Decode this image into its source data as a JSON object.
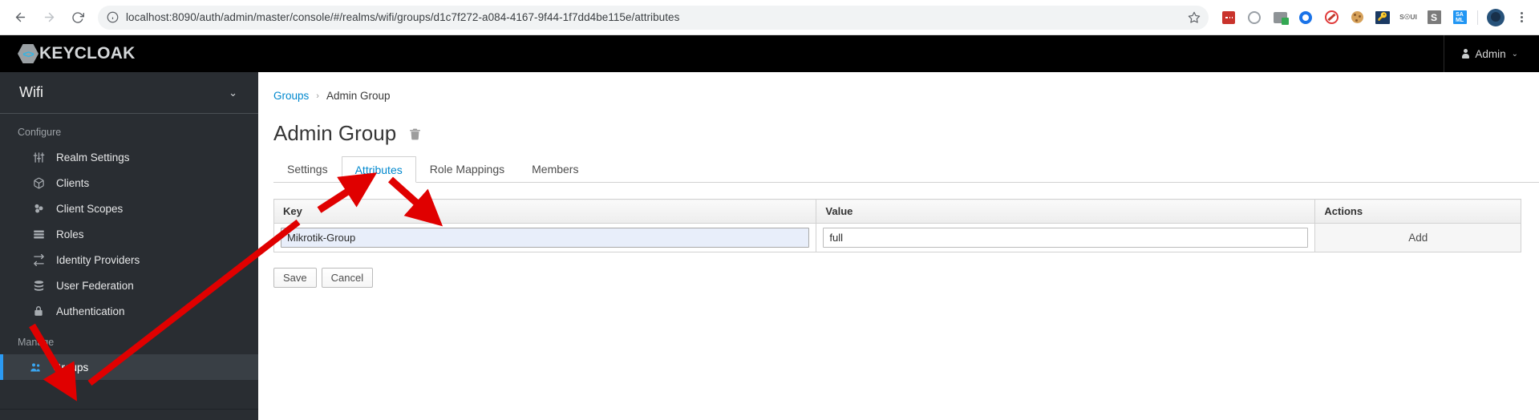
{
  "browser": {
    "back_label": "Back",
    "forward_label": "Forward",
    "reload_label": "Reload",
    "url": "localhost:8090/auth/admin/master/console/#/realms/wifi/groups/d1c7f272-a084-4167-9f44-1f7dd4be115e/attributes",
    "site_info_label": "View site information",
    "bookmark_label": "Bookmark this tab",
    "extensions": [
      {
        "name": "ublock-origin-icon",
        "label": "uBlock Origin"
      },
      {
        "name": "ring-extension-icon",
        "label": "Extension"
      },
      {
        "name": "print-friendly-icon",
        "label": "Print Friendly"
      },
      {
        "name": "blue-circle-extension-icon",
        "label": "Extension"
      },
      {
        "name": "red-block-extension-icon",
        "label": "Extension"
      },
      {
        "name": "cookie-editor-icon",
        "label": "Cookie Editor"
      },
      {
        "name": "keystore-explorer-icon",
        "label": "Key Tool"
      },
      {
        "name": "soap-ui-icon",
        "label": "SOAP"
      },
      {
        "name": "s-extension-icon",
        "label": "S"
      },
      {
        "name": "saml-tracer-icon",
        "label": "SAML"
      }
    ],
    "profile_label": "Profile",
    "menu_label": "Customize and control"
  },
  "header": {
    "logo_text": "KEYCLOAK",
    "logo_mark": "<>",
    "user_name": "Admin",
    "user_caret": "⌄"
  },
  "sidebar": {
    "realm": "Wifi",
    "realm_caret": "⌄",
    "sections": [
      {
        "title": "Configure",
        "items": [
          {
            "label": "Realm Settings",
            "icon": "sliders-icon",
            "active": false
          },
          {
            "label": "Clients",
            "icon": "cube-icon",
            "active": false
          },
          {
            "label": "Client Scopes",
            "icon": "scopes-icon",
            "active": false
          },
          {
            "label": "Roles",
            "icon": "list-icon",
            "active": false
          },
          {
            "label": "Identity Providers",
            "icon": "exchange-icon",
            "active": false
          },
          {
            "label": "User Federation",
            "icon": "database-icon",
            "active": false
          },
          {
            "label": "Authentication",
            "icon": "lock-icon",
            "active": false
          }
        ]
      },
      {
        "title": "Manage",
        "items": [
          {
            "label": "Groups",
            "icon": "users-icon",
            "active": true
          }
        ]
      }
    ]
  },
  "main": {
    "breadcrumb": {
      "root": "Groups",
      "separator": "›",
      "current": "Admin Group"
    },
    "page_title": "Admin Group",
    "delete_label": "Delete group",
    "tabs": [
      {
        "label": "Settings",
        "active": false
      },
      {
        "label": "Attributes",
        "active": true
      },
      {
        "label": "Role Mappings",
        "active": false
      },
      {
        "label": "Members",
        "active": false
      }
    ],
    "table": {
      "columns": [
        "Key",
        "Value",
        "Actions"
      ],
      "rows": [
        {
          "key": "Mikrotik-Group",
          "value": "full",
          "action": "Add"
        }
      ]
    },
    "buttons": {
      "save": "Save",
      "cancel": "Cancel"
    }
  },
  "annotations": {
    "arrow_color": "#e00000",
    "arrows": [
      {
        "name": "arrow-to-attributes-tab",
        "target": "Attributes tab"
      },
      {
        "name": "arrow-to-key-field",
        "target": "Key input field"
      },
      {
        "name": "arrow-to-groups-nav",
        "target": "Groups sidebar item"
      }
    ]
  },
  "colors": {
    "keycloak_black": "#000000",
    "sidebar_bg": "#292d32",
    "accent_blue": "#0088ce",
    "active_nav_blue": "#2b9af3",
    "autofill_blue": "#e8eefa"
  }
}
